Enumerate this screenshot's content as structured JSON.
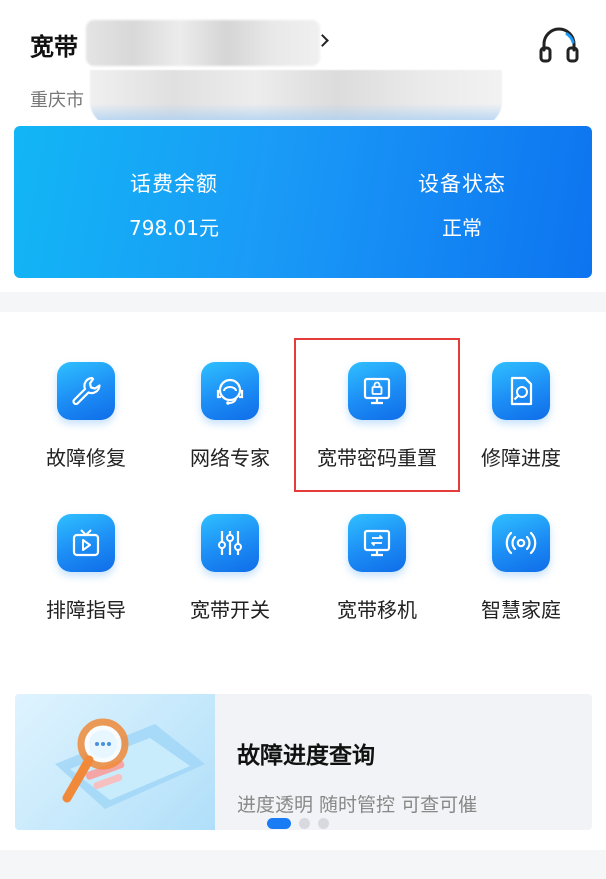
{
  "header": {
    "title": "宽带",
    "address_prefix": "重庆市"
  },
  "account": {
    "balance_label": "话费余额",
    "balance_value": "798.01元",
    "device_label": "设备状态",
    "device_value": "正常"
  },
  "services": [
    {
      "label": "故障修复",
      "icon": "wrench-icon"
    },
    {
      "label": "网络专家",
      "icon": "headset-agent-icon"
    },
    {
      "label": "宽带密码重置",
      "icon": "password-reset-icon"
    },
    {
      "label": "修障进度",
      "icon": "progress-document-icon"
    },
    {
      "label": "排障指导",
      "icon": "tv-play-icon"
    },
    {
      "label": "宽带开关",
      "icon": "sliders-icon"
    },
    {
      "label": "宽带移机",
      "icon": "monitor-transfer-icon"
    },
    {
      "label": "智慧家庭",
      "icon": "wireless-signal-icon"
    }
  ],
  "banner": {
    "title": "故障进度查询",
    "subtitle": "进度透明 随时管控 可查可催"
  },
  "colors": {
    "accent": "#1a7cf4",
    "highlight_border": "#e63b3b"
  }
}
